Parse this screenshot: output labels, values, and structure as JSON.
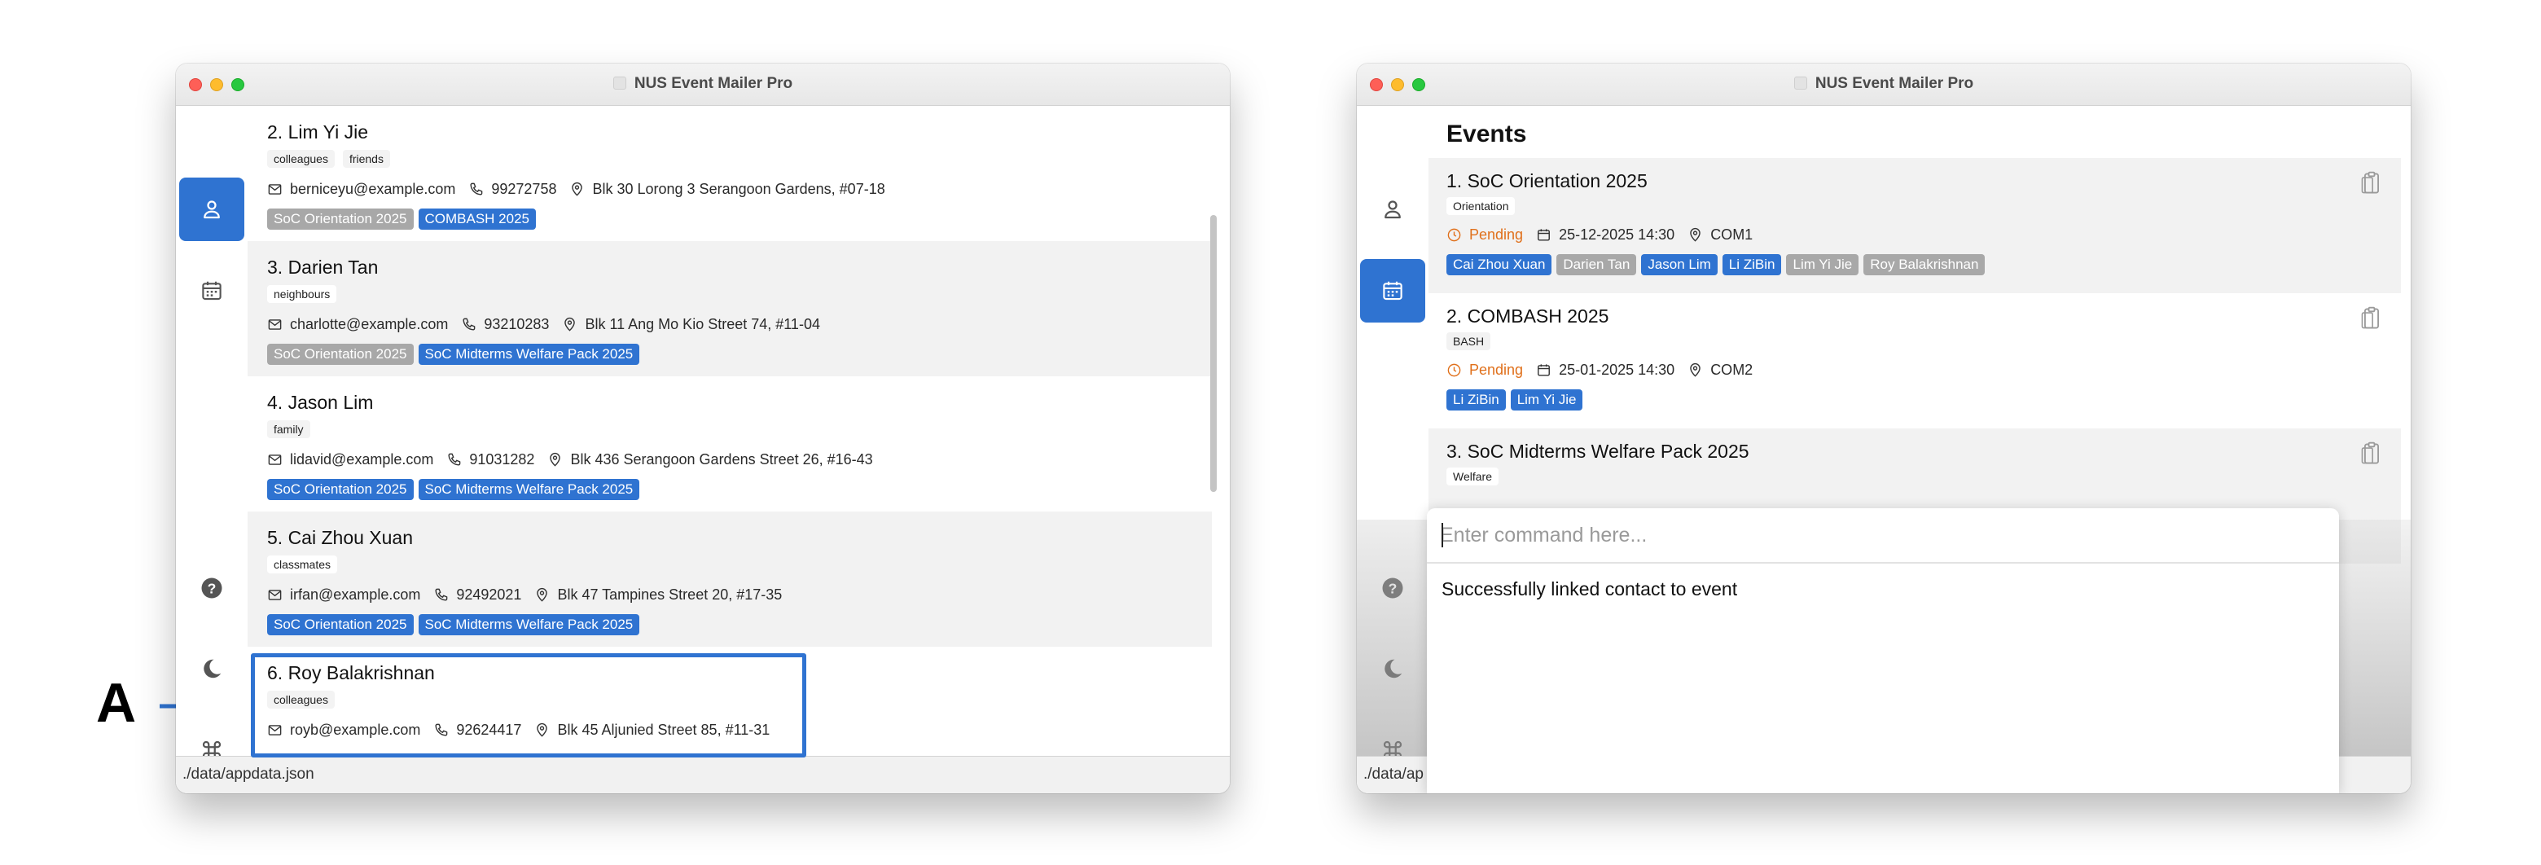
{
  "annotation": {
    "label": "A"
  },
  "left_window": {
    "title": "NUS Event Mailer Pro",
    "status_path": "./data/appdata.json",
    "contacts": [
      {
        "name": "2. Lim Yi Jie",
        "tags": [
          "colleagues",
          "friends"
        ],
        "email": "berniceyu@example.com",
        "phone": "99272758",
        "address": "Blk 30 Lorong 3 Serangoon Gardens, #07-18",
        "events": [
          {
            "label": "SoC Orientation 2025",
            "color": "grey"
          },
          {
            "label": "COMBASH 2025",
            "color": "blue"
          }
        ]
      },
      {
        "name": "3. Darien Tan",
        "tags": [
          "neighbours"
        ],
        "email": "charlotte@example.com",
        "phone": "93210283",
        "address": "Blk 11 Ang Mo Kio Street 74, #11-04",
        "events": [
          {
            "label": "SoC Orientation 2025",
            "color": "grey"
          },
          {
            "label": "SoC Midterms Welfare Pack 2025",
            "color": "blue"
          }
        ]
      },
      {
        "name": "4. Jason Lim",
        "tags": [
          "family"
        ],
        "email": "lidavid@example.com",
        "phone": "91031282",
        "address": "Blk 436 Serangoon Gardens Street 26, #16-43",
        "events": [
          {
            "label": "SoC Orientation 2025",
            "color": "blue"
          },
          {
            "label": "SoC Midterms Welfare Pack 2025",
            "color": "blue"
          }
        ]
      },
      {
        "name": "5. Cai Zhou Xuan",
        "tags": [
          "classmates"
        ],
        "email": "irfan@example.com",
        "phone": "92492021",
        "address": "Blk 47 Tampines Street 20, #17-35",
        "events": [
          {
            "label": "SoC Orientation 2025",
            "color": "blue"
          },
          {
            "label": "SoC Midterms Welfare Pack 2025",
            "color": "blue"
          }
        ]
      },
      {
        "name": "6. Roy Balakrishnan",
        "tags": [
          "colleagues"
        ],
        "email": "royb@example.com",
        "phone": "92624417",
        "address": "Blk 45 Aljunied Street 85, #11-31",
        "events": []
      }
    ]
  },
  "right_window": {
    "title": "NUS Event Mailer Pro",
    "heading": "Events",
    "status_path": "./data/ap",
    "events": [
      {
        "name": "1. SoC Orientation 2025",
        "tag": "Orientation",
        "status": "Pending",
        "datetime": "25-12-2025 14:30",
        "venue": "COM1",
        "contacts": [
          {
            "label": "Cai Zhou Xuan",
            "color": "blue"
          },
          {
            "label": "Darien Tan",
            "color": "grey"
          },
          {
            "label": "Jason Lim",
            "color": "blue"
          },
          {
            "label": "Li ZiBin",
            "color": "blue"
          },
          {
            "label": "Lim Yi Jie",
            "color": "grey"
          },
          {
            "label": "Roy Balakrishnan",
            "color": "grey"
          }
        ]
      },
      {
        "name": "2. COMBASH 2025",
        "tag": "BASH",
        "status": "Pending",
        "datetime": "25-01-2025 14:30",
        "venue": "COM2",
        "contacts": [
          {
            "label": "Li ZiBin",
            "color": "blue"
          },
          {
            "label": "Lim Yi Jie",
            "color": "blue"
          }
        ]
      },
      {
        "name": "3. SoC Midterms Welfare Pack 2025",
        "tag": "Welfare"
      }
    ],
    "command": {
      "placeholder": "Enter command here...",
      "value": "",
      "result": "Successfully linked contact to event"
    }
  },
  "icons": {
    "contacts": "person-icon",
    "events": "calendar-icon",
    "help": "question-icon",
    "theme": "moon-icon",
    "shortcuts": "command-icon",
    "email": "mail-icon",
    "phone": "phone-icon",
    "address": "location-pin-icon",
    "status": "clock-icon",
    "date": "calendar-icon",
    "copy": "clipboard-icon"
  },
  "colors": {
    "accent": "#2f73d1",
    "grey_chip": "#a8a8a8",
    "pending": "#e0701b"
  }
}
